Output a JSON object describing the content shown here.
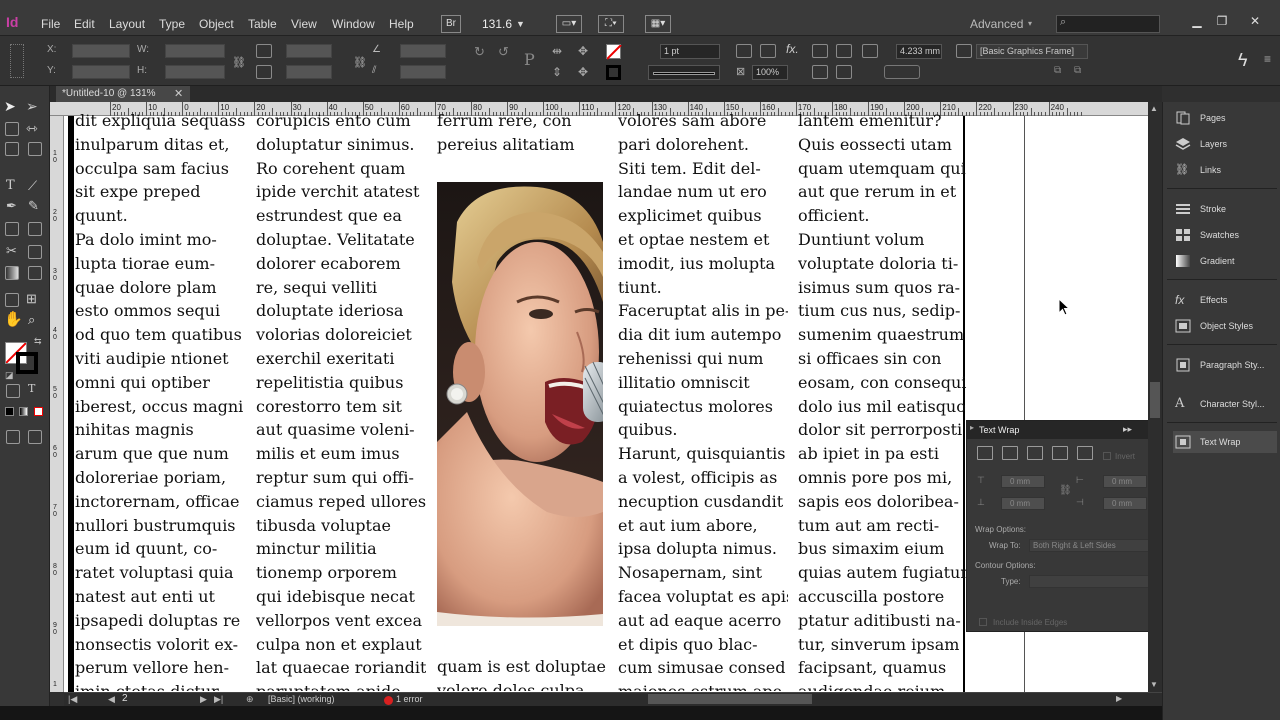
{
  "app": {
    "logo": "Id"
  },
  "menu": {
    "items": [
      "File",
      "Edit",
      "Layout",
      "Type",
      "Object",
      "Table",
      "View",
      "Window",
      "Help"
    ],
    "bridge": "Br",
    "zoom": "131.6",
    "workspace": "Advanced"
  },
  "control": {
    "x_label": "X:",
    "y_label": "Y:",
    "w_label": "W:",
    "h_label": "H:",
    "stroke_weight": "1 pt",
    "gap": "4.233 mm",
    "scale": "100%",
    "style": "[Basic Graphics Frame]"
  },
  "document": {
    "tab_title": "*Untitled-10 @ 131%",
    "ruler_labels": [
      "20",
      "10",
      "0",
      "10",
      "20",
      "30",
      "40",
      "50",
      "60",
      "70",
      "80",
      "90",
      "100",
      "110",
      "120",
      "130",
      "140",
      "150",
      "160",
      "170",
      "180",
      "190",
      "200",
      "210",
      "220",
      "230",
      "240"
    ],
    "vruler_labels": [
      "1",
      "0",
      "2",
      "0",
      "3",
      "0",
      "4",
      "0",
      "5",
      "0",
      "6",
      "0",
      "7",
      "0",
      "8",
      "0",
      "9",
      "0",
      "1",
      "0",
      "1",
      "1"
    ],
    "columns": [
      [
        "dit expliquia sequass",
        "inulparum ditas et,",
        "occulpa sam facius",
        "sit expe preped",
        "quunt.",
        "Pa dolo imint mo-",
        "lupta tiorae eum-",
        "quae dolore plam",
        "esto ommos sequi",
        "od quo tem quatibus",
        "viti audipie ntionet",
        "omni qui optiber",
        "iberest, occus magni",
        "nihitas magnis",
        "arum que que num",
        "doloreriae poriam,",
        "inctorernam, officae",
        "nullori bustrumquis",
        "eum id quunt, co-",
        "ratet voluptasi quia",
        "natest aut enti ut",
        "ipsapedi doluptas re",
        "nonsectis volorit ex-",
        "perum vellore hen-",
        "imin ctotas dictur"
      ],
      [
        "corupicis ento cum",
        "doluptatur sinimus.",
        "Ro corehent quam",
        "ipide verchit atatest",
        "estrundest que ea",
        "doluptae. Velitatate",
        "dolorer ecaborem",
        "re, sequi vellitі",
        "doluptate ideriosa",
        "volorias doloreiciet",
        "exerchil exeritati",
        "repelitistia quibus",
        "corestorro tem sit",
        "aut quasime voleni-",
        "milis et eum imus",
        "reptur sum qui offi-",
        "ciamus reped ullores",
        "tibusda voluptae",
        "minctur militia",
        "tionemp orporem",
        "qui idebisque necat",
        "vellorpos vent excea",
        "culpa non et explaut",
        "lat quaecae roriandit",
        "paruptatem apide"
      ],
      [
        "ferrum rere, con",
        "pereius alitatiam"
      ],
      [
        "volores sam abore",
        "pari dolorehent.",
        "Siti tem. Edit del-",
        "landae num ut ero",
        "explicimet quibus",
        "et optae nestem et",
        "imodit, ius molupta",
        "tiunt.",
        "Faceruptat alis in pe-",
        "dia dit ium autempo",
        "rehenissi qui num",
        "illitatio omniscit",
        "quiatectus molores",
        "quibus.",
        "Harunt, quisquiantis",
        "a volest, officipis as",
        "necuption cusdandit",
        "et aut ium abore,",
        "ipsa dolupta nimus.",
        "Nosapernam, sint",
        "facea voluptat es apis",
        "aut ad eaque acerro",
        "et dipis quo blac-",
        "cum simusae consed",
        "maiones estrum ape"
      ],
      [
        "lantem emenitur?",
        "Quis eossecti utam",
        "quam utemquam qui",
        "aut que rerum in et",
        "officient.",
        "Duntiunt volum",
        "voluptate doloria ti-",
        "isimus sum quos ra-",
        "tium cus nus, sedip-",
        "sumenim quaestrum",
        "si officaes sin con",
        "eosam, con consequi",
        "dolo ius mil eatisquo",
        "dolor sit perrorposti",
        "ab ipiet in pa esti",
        "omnis pore pos mi,",
        "sapis eos doloribea-",
        "tum aut am recti-",
        "bus simaxim eium",
        "quias autem fugiatur",
        "accuscilla postore",
        "ptatur aditibusti na-",
        "tur, sinverum ipsam",
        "facipsant, quamus",
        "audigendae reium"
      ]
    ],
    "col3_bottom": [
      "quam is est doluptae",
      "volore doles culpa"
    ]
  },
  "status": {
    "page": "2",
    "preflight_profile": "[Basic] (working)",
    "errors": "1 error"
  },
  "dock": {
    "items": [
      "Pages",
      "Layers",
      "Links",
      "Stroke",
      "Swatches",
      "Gradient",
      "Effects",
      "Object Styles",
      "Paragraph Sty...",
      "Character Styl...",
      "Text Wrap"
    ]
  },
  "text_wrap": {
    "title": "Text Wrap",
    "invert": "Invert",
    "top_offset": "0 mm",
    "bottom_offset": "0 mm",
    "left_offset": "0 mm",
    "right_offset": "0 mm",
    "wrap_options_label": "Wrap Options:",
    "wrap_to_label": "Wrap To:",
    "wrap_to_value": "Both Right & Left Sides",
    "contour_options_label": "Contour Options:",
    "type_label": "Type:",
    "include_inside_edges": "Include Inside Edges"
  }
}
